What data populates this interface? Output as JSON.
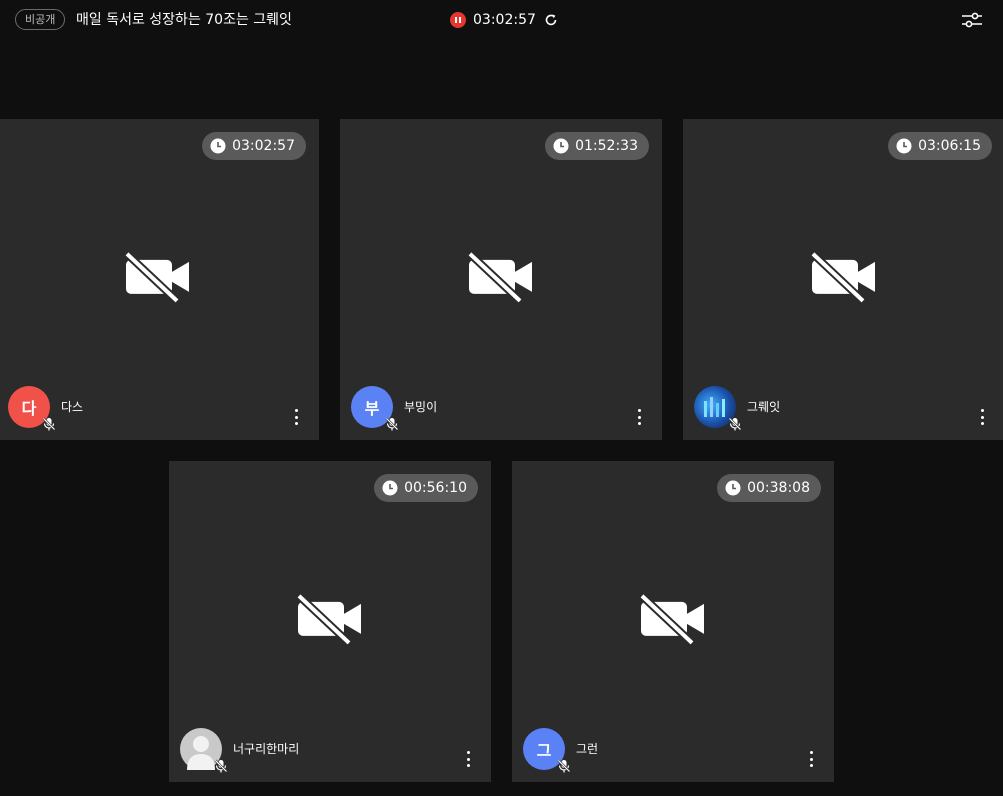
{
  "header": {
    "privacy_label": "비공개",
    "room_title": "매일 독서로 성장하는 70조는 그뤠잇",
    "session_time": "03:02:57",
    "record_color": "#e5362f"
  },
  "participants": [
    {
      "name": "다스",
      "timer": "03:02:57",
      "avatar_text": "다",
      "avatar_color": "#f0524a",
      "avatar_type": "initial"
    },
    {
      "name": "부밍이",
      "timer": "01:52:33",
      "avatar_text": "부",
      "avatar_color": "#5b82f5",
      "avatar_type": "initial"
    },
    {
      "name": "그뤠잇",
      "timer": "03:06:15",
      "avatar_text": "",
      "avatar_color": "#1a4fa8",
      "avatar_type": "photo"
    },
    {
      "name": "너구리한마리",
      "timer": "00:56:10",
      "avatar_text": "",
      "avatar_color": "#c9c9c9",
      "avatar_type": "silhouette"
    },
    {
      "name": "그런",
      "timer": "00:38:08",
      "avatar_text": "그",
      "avatar_color": "#5b82f5",
      "avatar_type": "initial"
    }
  ]
}
